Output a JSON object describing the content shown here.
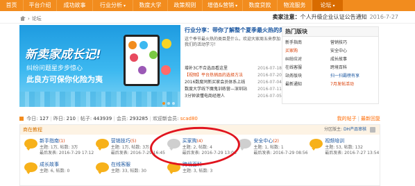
{
  "nav": {
    "items": [
      {
        "label": "首页"
      },
      {
        "label": "平台介绍"
      },
      {
        "label": "成功故事"
      },
      {
        "label": "行业分析",
        "caret": "▾"
      },
      {
        "label": "数度大学"
      },
      {
        "label": "政策规则"
      },
      {
        "label": "增值&营销",
        "caret": "▾"
      },
      {
        "label": "数度贷款"
      },
      {
        "label": "物流服务"
      },
      {
        "label": "论坛",
        "caret": "▾",
        "active": true
      }
    ]
  },
  "notice": {
    "prefix": "卖家注意：",
    "text": "个人升级企业认证公告通知",
    "date": "2016-7-27"
  },
  "breadcrumb": {
    "current": "论坛"
  },
  "banner": {
    "title": "新卖家成长记!",
    "line1": "纠纷问题星步步惊心",
    "line2": "此良方可保你化险为夷"
  },
  "news": {
    "headline": "行业分享：带你了解整个夏季最火热的类目",
    "intro": "这个季节最火热的类目是什么，欢迎大家周五来参加我们的活动学习！",
    "items": [
      {
        "title": "增补3C不合选品看这里",
        "date": "2016-07-18",
        "highlight": false
      },
      {
        "title": "【视频】平台热销品的选择方法",
        "date": "2016-07-20",
        "highlight": true
      },
      {
        "title": "2016数度同新买家会员体系上线",
        "date": "2016-07-04",
        "highlight": false
      },
      {
        "title": "数度大学线下魔鬼训练营—深圳站",
        "date": "2016-07-11",
        "highlight": false
      },
      {
        "title": "3分钟读懂电商经理人",
        "date": "2016-07-05",
        "highlight": false
      }
    ]
  },
  "hot": {
    "heading": "热门版块",
    "items": [
      {
        "label": "新手指南",
        "style": "normal"
      },
      {
        "label": "营销技巧",
        "style": "normal"
      },
      {
        "label": "买家购",
        "style": "red"
      },
      {
        "label": "安全中心",
        "style": "normal"
      },
      {
        "label": "纠纷应对",
        "style": "normal"
      },
      {
        "label": "成长故事",
        "style": "normal"
      },
      {
        "label": "在线客服",
        "style": "normal"
      },
      {
        "label": "跨境百科",
        "style": "normal"
      },
      {
        "label": "站务版块",
        "style": "normal"
      },
      {
        "label": "扫一扫霸榜有享",
        "style": "blue"
      },
      {
        "label": "最新通知",
        "style": "normal"
      },
      {
        "label": "7月发帖活动",
        "style": "red"
      }
    ]
  },
  "stats": {
    "today_label": "今日:",
    "today": "127",
    "yesterday_label": "昨日:",
    "yesterday": "210",
    "posts_label": "帖子:",
    "posts": "443939",
    "members_label": "会员:",
    "members": "293285",
    "newest_label": "欢迎新会员:",
    "newest": "scad80",
    "my_posts": "我的帖子",
    "latest_reply": "最新回复"
  },
  "forum": {
    "section_title": "商在教程",
    "moderator_label": "分区版主:",
    "moderator": "DH产品审核",
    "boards_row1": [
      {
        "name": "新手指南",
        "new": "(1)",
        "meta": "主题: 1万, 帖数: 3万",
        "last": "最后发表: 2016-7-29 17:12",
        "icon": "gold"
      },
      {
        "name": "营销技巧",
        "new": "(5)",
        "meta": "主题: 1万, 帖数: 3万",
        "last": "最后发表: 2016-7-29 16:45",
        "icon": "gold"
      },
      {
        "name": "买家购",
        "new": "(4)",
        "meta": "主题: 2, 帖数: 4",
        "last": "最后发表: 2016-7-29 13:06",
        "icon": "grey"
      },
      {
        "name": "安全中心",
        "new": "(2)",
        "meta": "主题: 1, 帖数: 1",
        "last": "最后发表: 2016-7-29 08:56",
        "icon": "grey"
      },
      {
        "name": "视频培训",
        "new": "",
        "meta": "主题: 53, 帖数: 132",
        "last": "最后发表: 2016-7-27 13:54",
        "icon": "gold"
      }
    ],
    "boards_row2": [
      {
        "name": "成长故事",
        "new": "",
        "meta": "主题: 6, 帖数: 0",
        "last": "",
        "icon": "gold"
      },
      {
        "name": "在线客服",
        "new": "",
        "meta": "主题: 33, 帖数: 30",
        "last": "",
        "icon": "gold"
      },
      {
        "name": "跨境百科",
        "new": "",
        "meta": "主题: 3, 帖数: 3",
        "last": "",
        "icon": "gold"
      }
    ]
  },
  "colors": {
    "nav_bg": "#f28c1e",
    "nav_active": "#d86b00",
    "link_blue": "#1a56a0",
    "highlight_red": "#d93b00",
    "annotation_red": "#e0141e",
    "board_icon_gold": "#f7b11a"
  }
}
